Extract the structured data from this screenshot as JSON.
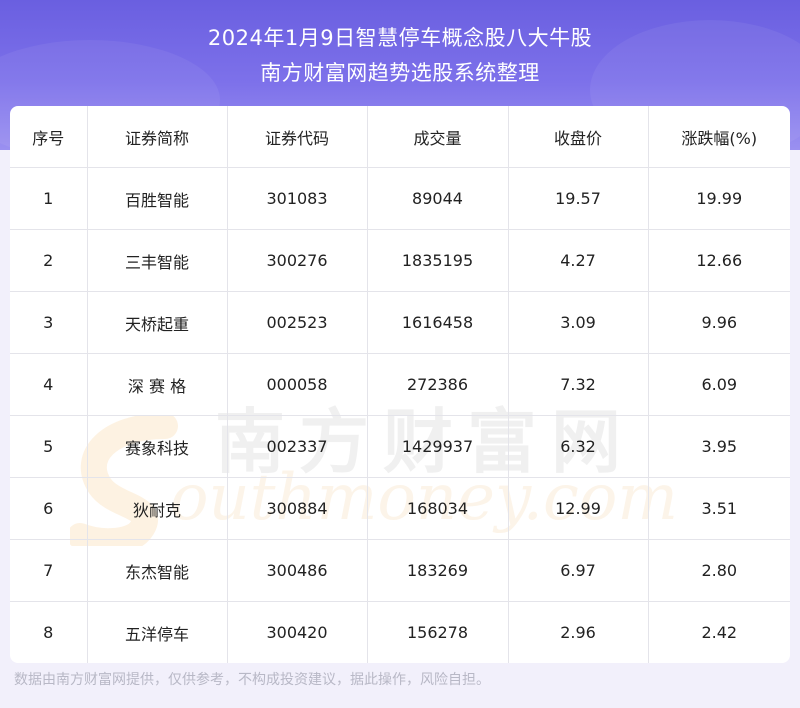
{
  "header": {
    "title_line1": "2024年1月9日智慧停车概念股八大牛股",
    "title_line2": "南方财富网趋势选股系统整理"
  },
  "table": {
    "columns": [
      "序号",
      "证券简称",
      "证券代码",
      "成交量",
      "收盘价",
      "涨跌幅(%)"
    ],
    "rows": [
      [
        "1",
        "百胜智能",
        "301083",
        "89044",
        "19.57",
        "19.99"
      ],
      [
        "2",
        "三丰智能",
        "300276",
        "1835195",
        "4.27",
        "12.66"
      ],
      [
        "3",
        "天桥起重",
        "002523",
        "1616458",
        "3.09",
        "9.96"
      ],
      [
        "4",
        "深 赛 格",
        "000058",
        "272386",
        "7.32",
        "6.09"
      ],
      [
        "5",
        "赛象科技",
        "002337",
        "1429937",
        "6.32",
        "3.95"
      ],
      [
        "6",
        "狄耐克",
        "300884",
        "168034",
        "12.99",
        "3.51"
      ],
      [
        "7",
        "东杰智能",
        "300486",
        "183269",
        "6.97",
        "2.80"
      ],
      [
        "8",
        "五洋停车",
        "300420",
        "156278",
        "2.96",
        "2.42"
      ]
    ]
  },
  "watermark": {
    "cn": "南方财富网",
    "en": "outhmoney.com"
  },
  "footer": {
    "disclaimer": "数据由南方财富网提供，仅供参考，不构成投资建议，据此操作，风险自担。"
  },
  "colors": {
    "header_top": "#6a5fe0",
    "header_bottom": "#9a90f0",
    "background": "#f2f0fb"
  }
}
